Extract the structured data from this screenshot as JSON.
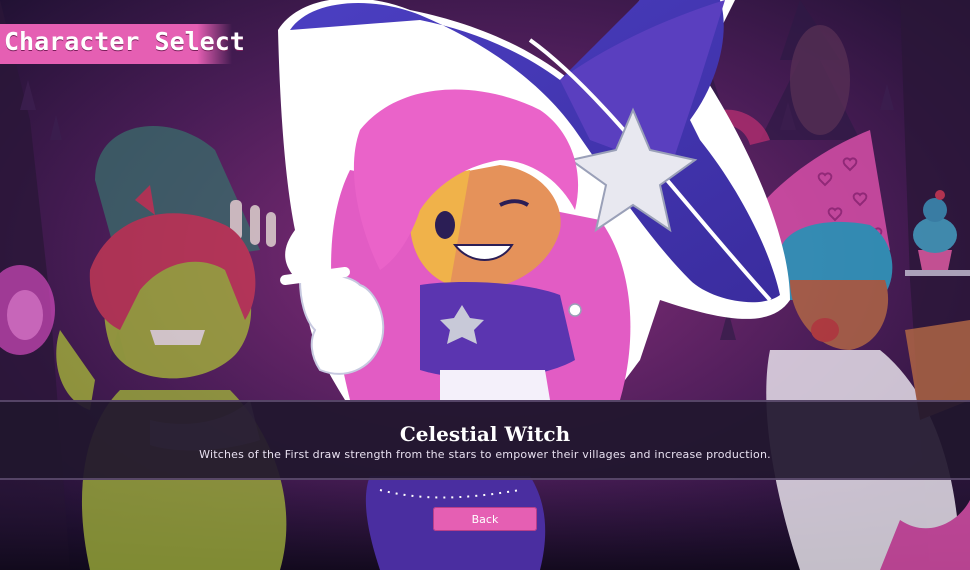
{
  "screen": {
    "title": "Character Select"
  },
  "characters": [
    {
      "id": "goblin",
      "position": "left"
    },
    {
      "id": "celestial-witch",
      "position": "center",
      "selected": true
    },
    {
      "id": "baker",
      "position": "right"
    }
  ],
  "selected_character": {
    "name": "Celestial Witch",
    "description": "Witches of the First draw strength from the stars to empower their villages and increase production."
  },
  "actions": {
    "back_label": "Back"
  },
  "colors": {
    "accent_pink": "#e55fb3",
    "panel_dark": "#21172e",
    "hat_purple": "#4a3bb3"
  }
}
